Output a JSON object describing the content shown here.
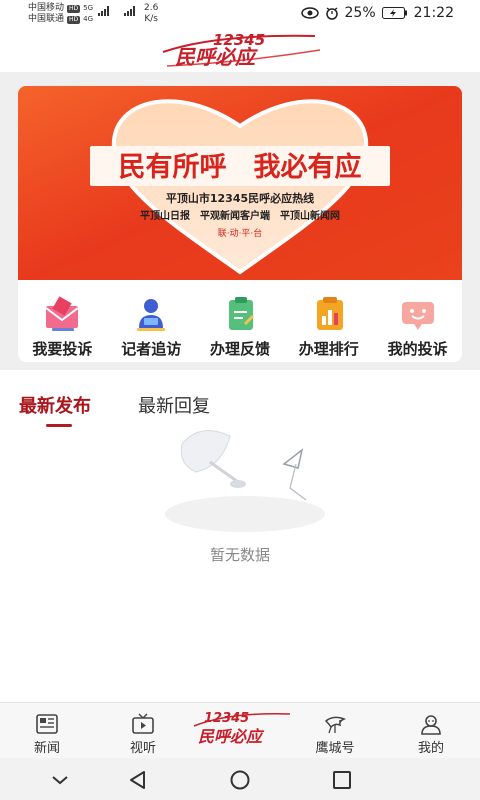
{
  "status_bar": {
    "carrier1": "中国移动",
    "carrier2": "中国联通",
    "hd": "HD",
    "net1": "5G",
    "net2": "4G",
    "speed_value": "2.6",
    "speed_unit": "K/s",
    "battery": "25%",
    "time": "21:22"
  },
  "header": {
    "logo_number": "12345",
    "logo_text": "民呼必应"
  },
  "banner": {
    "headline": "民有所呼　我必有应",
    "subtitle1": "平顶山市12345民呼必应热线",
    "subtitle2": "平顶山日报　平观新闻客户端　平顶山新闻网",
    "tagline": "联·动·平·台"
  },
  "quick_actions": [
    {
      "label": "我要投诉",
      "icon": "envelope-icon"
    },
    {
      "label": "记者追访",
      "icon": "reporter-icon"
    },
    {
      "label": "办理反馈",
      "icon": "clipboard-icon"
    },
    {
      "label": "办理排行",
      "icon": "bar-chart-icon"
    },
    {
      "label": "我的投诉",
      "icon": "message-box-icon"
    }
  ],
  "tabs": {
    "active": "最新发布",
    "inactive": "最新回复"
  },
  "empty_state": {
    "text": "暂无数据"
  },
  "bottom_nav": {
    "items": [
      {
        "label": "新闻",
        "icon": "newspaper-icon"
      },
      {
        "label": "视听",
        "icon": "tv-icon"
      },
      {
        "label": "鹰城号",
        "icon": "eagle-icon"
      },
      {
        "label": "我的",
        "icon": "user-icon"
      }
    ],
    "center_number": "12345",
    "center_text": "民呼必应"
  },
  "colors": {
    "brand_red": "#b01c22",
    "banner_orange": "#f0501e"
  }
}
